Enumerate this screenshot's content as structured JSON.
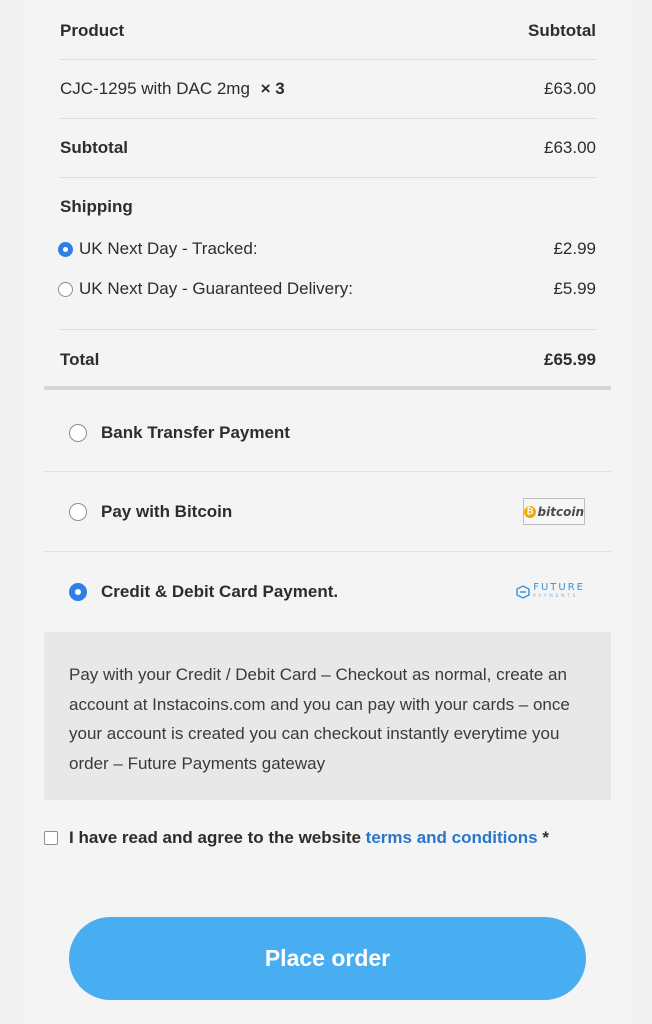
{
  "table": {
    "header": {
      "product": "Product",
      "subtotal": "Subtotal"
    },
    "item": {
      "name": "CJC-1295 with DAC 2mg",
      "qty": "× 3",
      "price": "£63.00"
    },
    "subtotal": {
      "label": "Subtotal",
      "value": "£63.00"
    },
    "shipping": {
      "label": "Shipping",
      "options": [
        {
          "label": "UK Next Day - Tracked:",
          "price": "£2.99",
          "selected": true
        },
        {
          "label": "UK Next Day - Guaranteed Delivery:",
          "price": "£5.99",
          "selected": false
        }
      ]
    },
    "total": {
      "label": "Total",
      "value": "£65.99"
    }
  },
  "payment": {
    "methods": [
      {
        "label": "Bank Transfer Payment",
        "selected": false
      },
      {
        "label": "Pay with Bitcoin",
        "selected": false,
        "logo_text": "bitcoin",
        "logo_icon": "bitcoin-icon"
      },
      {
        "label": "Credit & Debit Card Payment.",
        "selected": true,
        "logo_text": "FUTURE",
        "logo_sub": "PAYMENTS",
        "logo_icon": "future-payments-logo"
      }
    ],
    "description": "Pay with your Credit / Debit Card – Checkout as normal, create an account at Instacoins.com and you can pay with your cards – once your account is created you can checkout instantly everytime you order – Future Payments gateway"
  },
  "terms": {
    "text": "I have read and agree to the website",
    "link": "terms and conditions",
    "required": "*"
  },
  "place_order": {
    "label": "Place order"
  },
  "colors": {
    "accent": "#2f7fe6",
    "button": "#49aef1",
    "link": "#2a76c9"
  }
}
